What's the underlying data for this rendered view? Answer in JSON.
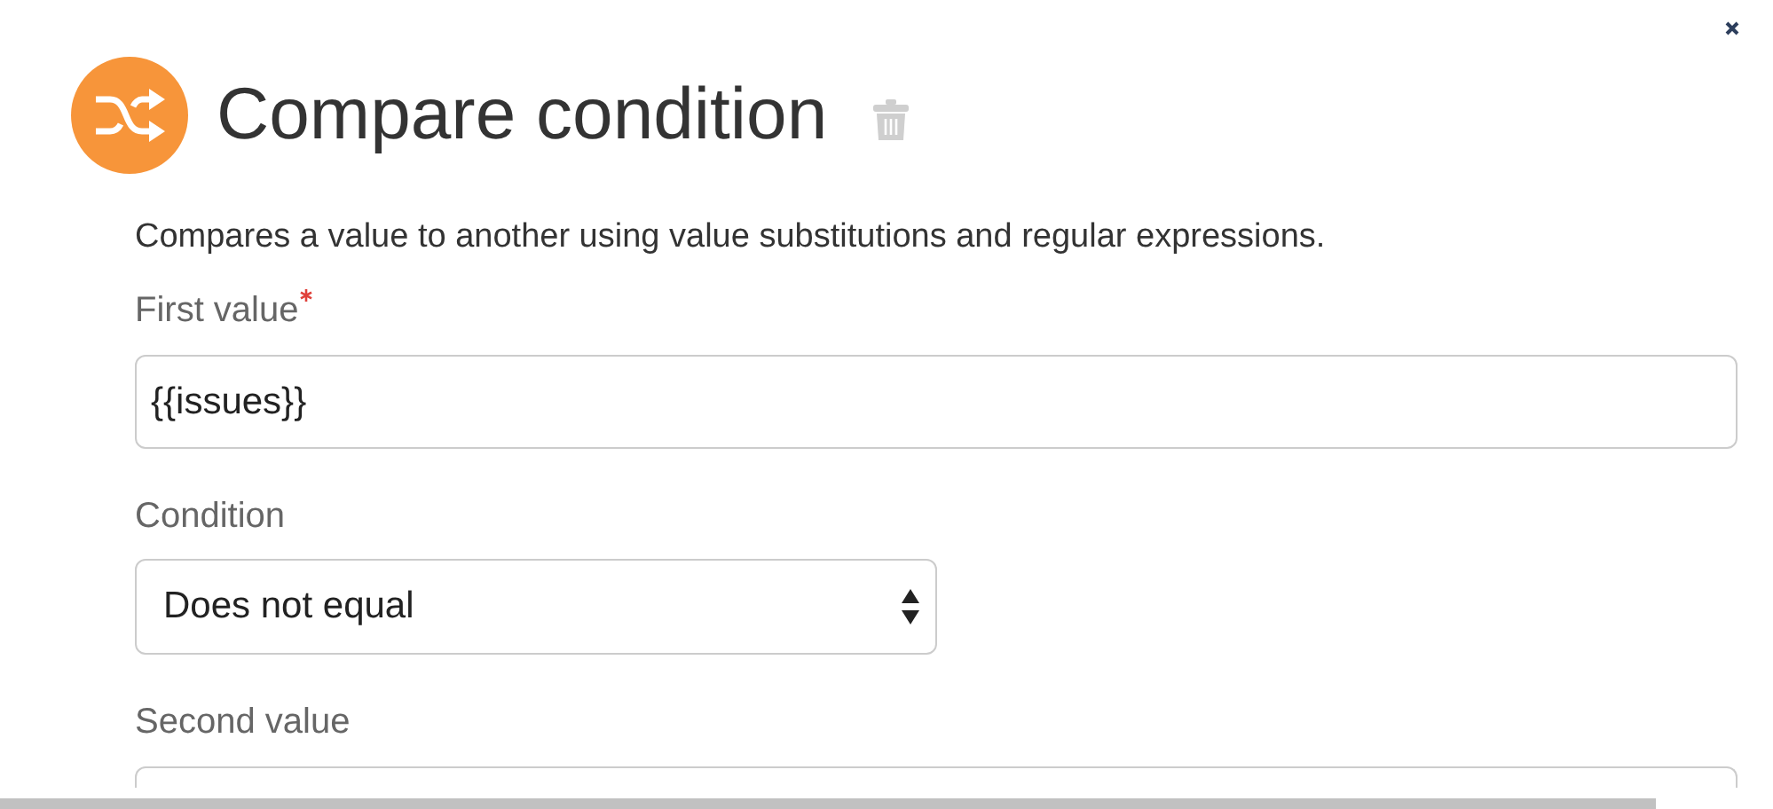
{
  "title": "Compare condition",
  "description": "Compares a value to another using value substitutions and regular expressions.",
  "fields": [
    {
      "kind": "text",
      "label": "First value",
      "required": true,
      "value": "{{issues}}"
    },
    {
      "kind": "select",
      "label": "Condition",
      "required": false,
      "value": "Does not equal"
    },
    {
      "kind": "text",
      "label": "Second value",
      "required": false
    }
  ]
}
